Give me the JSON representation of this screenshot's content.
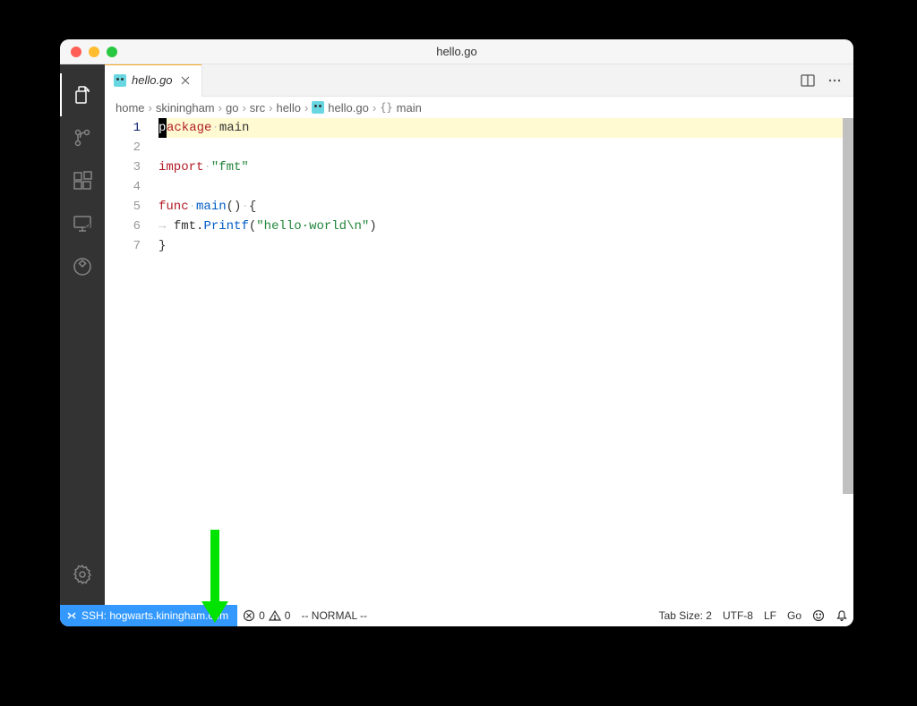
{
  "window": {
    "title": "hello.go"
  },
  "tab": {
    "label": "hello.go"
  },
  "breadcrumb": {
    "parts": [
      "home",
      "skiningham",
      "go",
      "src",
      "hello",
      "hello.go",
      "main"
    ],
    "symbolKind": "{}"
  },
  "code": {
    "lines": [
      {
        "n": 1,
        "tokens": [
          {
            "t": "p",
            "cursorBlock": true
          },
          {
            "t": "ackage",
            "c": "kw-package"
          },
          {
            "t": "·",
            "c": "ws-dot"
          },
          {
            "t": "main",
            "c": "kw-ident"
          }
        ],
        "current": true
      },
      {
        "n": 2,
        "tokens": []
      },
      {
        "n": 3,
        "tokens": [
          {
            "t": "import",
            "c": "kw-import"
          },
          {
            "t": "·",
            "c": "ws-dot"
          },
          {
            "t": "\"fmt\"",
            "c": "kw-str"
          }
        ]
      },
      {
        "n": 4,
        "tokens": []
      },
      {
        "n": 5,
        "tokens": [
          {
            "t": "func",
            "c": "kw-func"
          },
          {
            "t": "·",
            "c": "ws-dot"
          },
          {
            "t": "main",
            "c": "kw-type"
          },
          {
            "t": "()",
            "c": "kw-punc"
          },
          {
            "t": "·",
            "c": "ws-dot"
          },
          {
            "t": "{",
            "c": "kw-punc"
          }
        ]
      },
      {
        "n": 6,
        "tokens": [
          {
            "t": "→ ",
            "c": "ws-arrow"
          },
          {
            "t": "fmt",
            "c": "kw-ident"
          },
          {
            "t": ".",
            "c": "kw-dot"
          },
          {
            "t": "Printf",
            "c": "kw-call"
          },
          {
            "t": "(",
            "c": "kw-punc"
          },
          {
            "t": "\"hello·world\\n\"",
            "c": "kw-str"
          },
          {
            "t": ")",
            "c": "kw-punc"
          }
        ]
      },
      {
        "n": 7,
        "tokens": [
          {
            "t": "}",
            "c": "kw-punc"
          }
        ]
      }
    ]
  },
  "status": {
    "remote": "SSH: hogwarts.kiningham.com",
    "errors": "0",
    "warnings": "0",
    "vimMode": "-- NORMAL --",
    "tabSize": "Tab Size: 2",
    "encoding": "UTF-8",
    "eol": "LF",
    "lang": "Go"
  }
}
